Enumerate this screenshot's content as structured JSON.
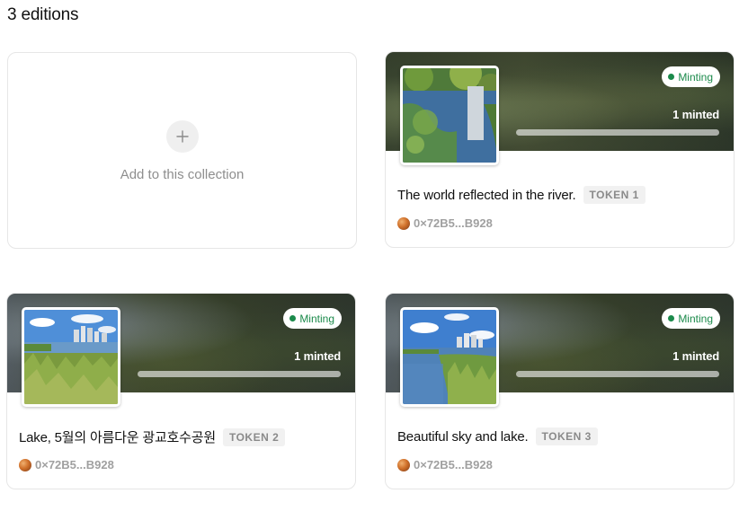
{
  "header": {
    "editions_count": "3 editions"
  },
  "add_card": {
    "label": "Add to this collection",
    "icon": "plus-icon"
  },
  "tokens": [
    {
      "title": "The world reflected in the river.",
      "tag": "TOKEN 1",
      "status": "Minting",
      "minted": "1 minted",
      "owner": "0×72B5...B928"
    },
    {
      "title": "Lake, 5월의 아름다운 광교호수공원",
      "tag": "TOKEN 2",
      "status": "Minting",
      "minted": "1 minted",
      "owner": "0×72B5...B928"
    },
    {
      "title": "Beautiful sky and lake.",
      "tag": "TOKEN 3",
      "status": "Minting",
      "minted": "1 minted",
      "owner": "0×72B5...B928"
    }
  ],
  "colors": {
    "minting": "#1b8a4b",
    "tag_bg": "#f1f1f1",
    "muted": "#8e8e8e"
  }
}
